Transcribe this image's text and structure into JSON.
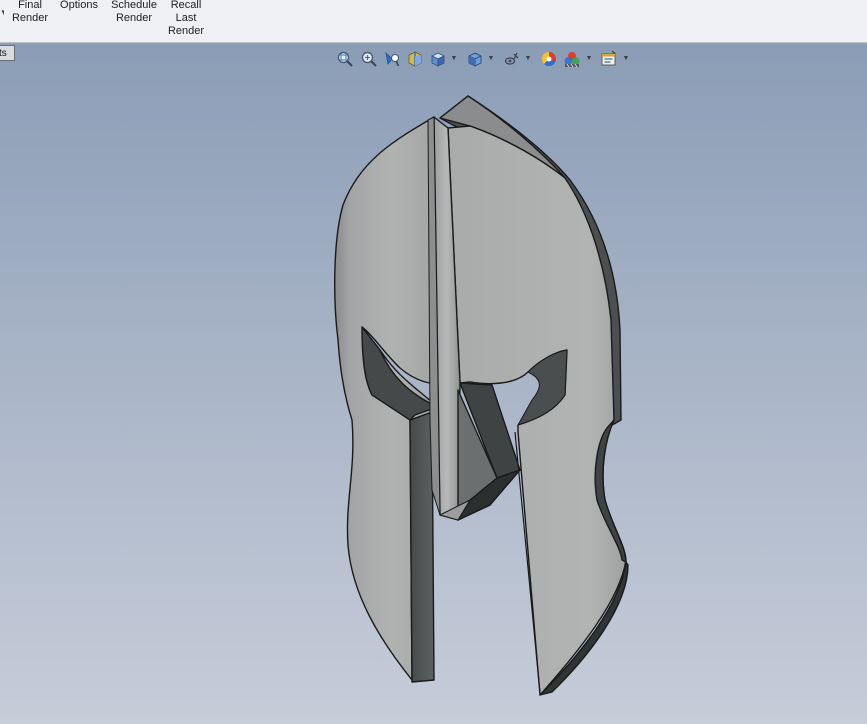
{
  "ribbon": {
    "buttons": [
      {
        "id": "final-render",
        "lines": [
          "Final",
          "Render"
        ]
      },
      {
        "id": "options",
        "lines": [
          "Options"
        ]
      },
      {
        "id": "schedule-render",
        "lines": [
          "Schedule",
          "Render"
        ]
      },
      {
        "id": "recall-last-render",
        "lines": [
          "Recall",
          "Last",
          "Render"
        ]
      }
    ]
  },
  "viewport": {
    "left_tab_label": "ts",
    "model_icon": "helmet-model",
    "heads_up_toolbar": [
      {
        "icon": "zoom-to-fit-icon"
      },
      {
        "icon": "zoom-to-area-icon"
      },
      {
        "icon": "previous-view-icon"
      },
      {
        "icon": "section-view-icon"
      },
      {
        "icon": "view-orientation-icon",
        "dropdown": true
      },
      {
        "icon": "display-style-icon",
        "dropdown": true
      },
      {
        "icon": "hide-show-items-icon",
        "dropdown": true
      },
      {
        "icon": "edit-appearance-icon"
      },
      {
        "icon": "apply-scene-icon",
        "dropdown": true
      },
      {
        "icon": "view-settings-icon",
        "dropdown": true
      }
    ],
    "colors": {
      "background_top": "#8b9db6",
      "background_bottom": "#c6cdd9",
      "model_face": "#a9abab",
      "model_edge": "#1a1a1a"
    }
  }
}
